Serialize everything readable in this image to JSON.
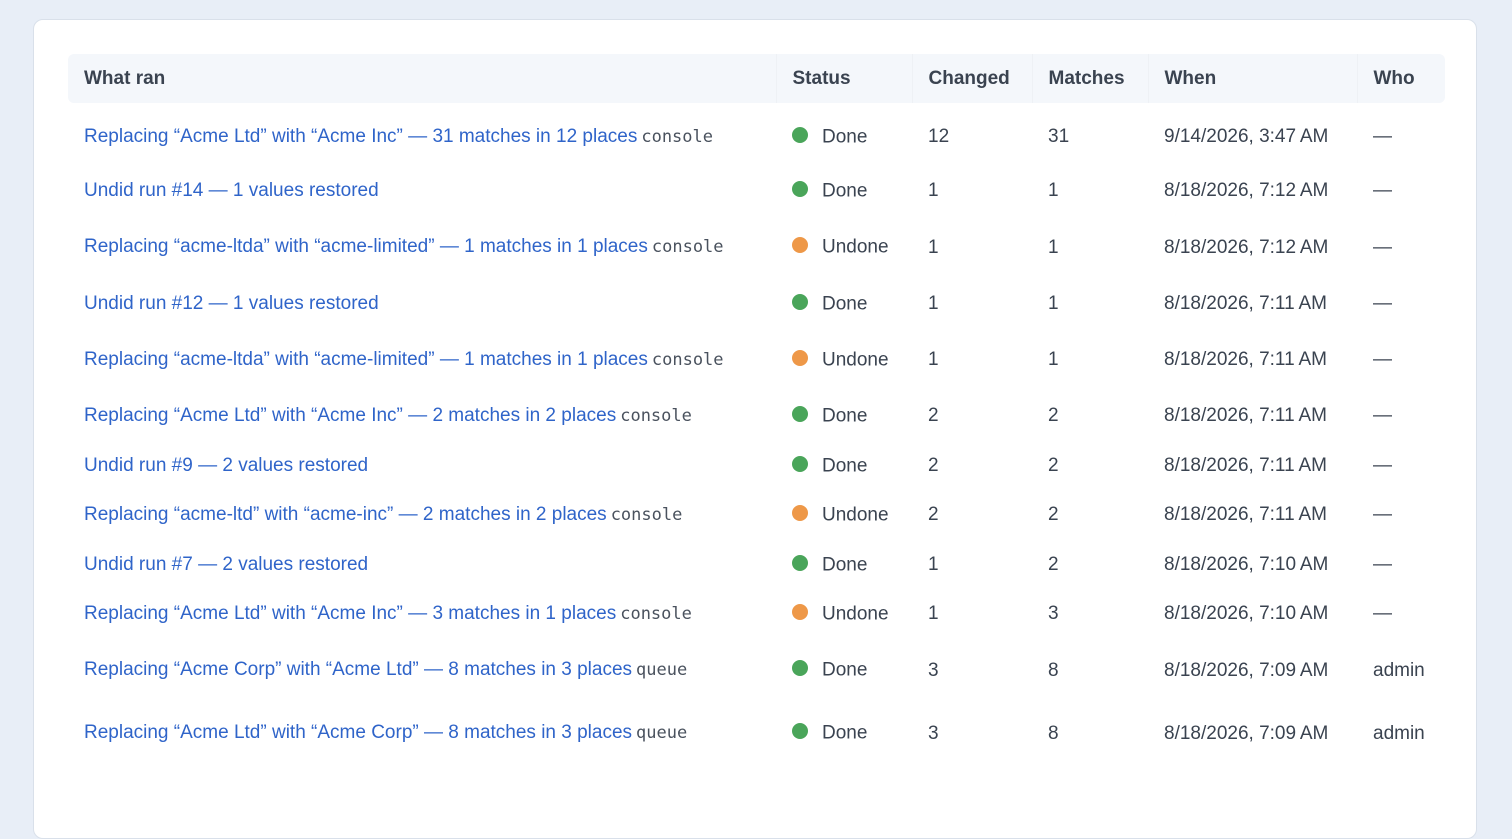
{
  "table": {
    "columns": [
      "What ran",
      "Status",
      "Changed",
      "Matches",
      "When",
      "Who"
    ],
    "rows": [
      {
        "what": "Replacing “Acme Ltd” with “Acme Inc” — 31 matches in 12 places",
        "source": "console",
        "status": "Done",
        "changed": "12",
        "matches": "31",
        "when": "9/14/2026, 3:47 AM",
        "who": "—",
        "tall": true
      },
      {
        "what": "Undid run #14 — 1 values restored",
        "source": "",
        "status": "Done",
        "changed": "1",
        "matches": "1",
        "when": "8/18/2026, 7:12 AM",
        "who": "—",
        "tall": false
      },
      {
        "what": "Replacing “acme-ltda” with “acme-limited” — 1 matches in 1 places",
        "source": "console",
        "status": "Undone",
        "changed": "1",
        "matches": "1",
        "when": "8/18/2026, 7:12 AM",
        "who": "—",
        "tall": true
      },
      {
        "what": "Undid run #12 — 1 values restored",
        "source": "",
        "status": "Done",
        "changed": "1",
        "matches": "1",
        "when": "8/18/2026, 7:11 AM",
        "who": "—",
        "tall": false
      },
      {
        "what": "Replacing “acme-ltda” with “acme-limited” — 1 matches in 1 places",
        "source": "console",
        "status": "Undone",
        "changed": "1",
        "matches": "1",
        "when": "8/18/2026, 7:11 AM",
        "who": "—",
        "tall": true
      },
      {
        "what": "Replacing “Acme Ltd” with “Acme Inc” — 2 matches in 2 places",
        "source": "console",
        "status": "Done",
        "changed": "2",
        "matches": "2",
        "when": "8/18/2026, 7:11 AM",
        "who": "—",
        "tall": false
      },
      {
        "what": "Undid run #9 — 2 values restored",
        "source": "",
        "status": "Done",
        "changed": "2",
        "matches": "2",
        "when": "8/18/2026, 7:11 AM",
        "who": "—",
        "tall": false
      },
      {
        "what": "Replacing “acme-ltd” with “acme-inc” — 2 matches in 2 places",
        "source": "console",
        "status": "Undone",
        "changed": "2",
        "matches": "2",
        "when": "8/18/2026, 7:11 AM",
        "who": "—",
        "tall": false
      },
      {
        "what": "Undid run #7 — 2 values restored",
        "source": "",
        "status": "Done",
        "changed": "1",
        "matches": "2",
        "when": "8/18/2026, 7:10 AM",
        "who": "—",
        "tall": false
      },
      {
        "what": "Replacing “Acme Ltd” with “Acme Inc” — 3 matches in 1 places",
        "source": "console",
        "status": "Undone",
        "changed": "1",
        "matches": "3",
        "when": "8/18/2026, 7:10 AM",
        "who": "—",
        "tall": false
      },
      {
        "what": "Replacing “Acme Corp” with “Acme Ltd” — 8 matches in 3 places",
        "source": "queue",
        "status": "Done",
        "changed": "3",
        "matches": "8",
        "when": "8/18/2026, 7:09 AM",
        "who": "admin",
        "tall": true
      },
      {
        "what": "Replacing “Acme Ltd” with “Acme Corp” — 8 matches in 3 places",
        "source": "queue",
        "status": "Done",
        "changed": "3",
        "matches": "8",
        "when": "8/18/2026, 7:09 AM",
        "who": "admin",
        "tall": true
      }
    ]
  },
  "status_colors": {
    "Done": "#4aa55a",
    "Undone": "#ee9848"
  }
}
